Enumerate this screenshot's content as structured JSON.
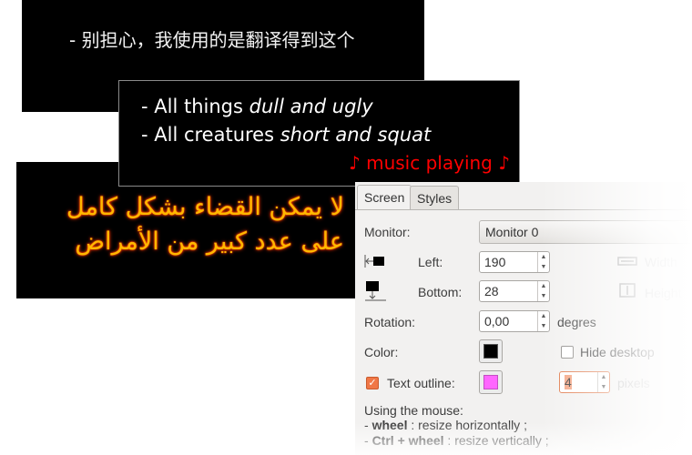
{
  "subtitles": {
    "chinese": "- 别担心，我使用的是翻译得到这个",
    "english_line1_plain": "- All things ",
    "english_line1_italic": "dull and ugly",
    "english_line2_plain": "- All creatures ",
    "english_line2_italic": "short and squat",
    "music": "♪ music playing ♪",
    "arabic_line1": "لا يمكن القضاء بشكل كامل",
    "arabic_line2": "على عدد كبير من الأمراض"
  },
  "tabs": [
    "Screen",
    "Styles"
  ],
  "monitor": {
    "label": "Monitor:",
    "value": "Monitor 0"
  },
  "left": {
    "label": "Left:",
    "value": "190"
  },
  "bottom": {
    "label": "Bottom:",
    "value": "28"
  },
  "width": {
    "label": "Width"
  },
  "height": {
    "label": "Height"
  },
  "rotation": {
    "label": "Rotation:",
    "value": "0,00",
    "unit": "degres"
  },
  "color": {
    "label": "Color:",
    "value": "#000000"
  },
  "hide_desktop": {
    "label": "Hide desktop",
    "checked": false
  },
  "text_outline": {
    "label": "Text outline:",
    "checked": true,
    "color": "#ff66ff",
    "pixels": "4",
    "unit": "pixels"
  },
  "mouse_help": {
    "title": "Using the mouse:",
    "line1_key": "wheel",
    "line1_desc": " : resize horizontally ;",
    "line2_key": "Ctrl + wheel",
    "line2_desc": " : resize vertically ;"
  },
  "colors": {
    "arabic_text": "#ffb800",
    "arabic_glow": "#ff3c00",
    "music_text": "#ff0000",
    "checkbox_accent": "#f07746"
  },
  "icons": [
    "left-edge-icon",
    "bottom-edge-icon",
    "width-icon",
    "height-icon",
    "spin-up-icon",
    "spin-down-icon",
    "check-icon"
  ]
}
